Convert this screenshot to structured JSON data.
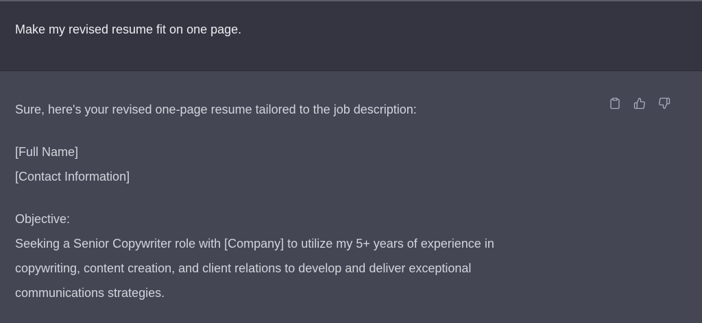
{
  "user_message": {
    "text": "Make my revised resume fit on one page."
  },
  "assistant_message": {
    "intro": "Sure, here's your revised one-page resume tailored to the job description:",
    "name_line": "[Full Name]",
    "contact_line": "[Contact Information]",
    "objective_heading": "Objective:",
    "objective_lines": [
      "Seeking a Senior Copywriter role with [Company] to utilize my 5+ years of experience in",
      "copywriting, content creation, and client relations to develop and deliver exceptional",
      "communications strategies."
    ]
  },
  "actions": {
    "icons": [
      "clipboard-icon",
      "thumbs-up-icon",
      "thumbs-down-icon"
    ]
  },
  "colors": {
    "user_bg": "#343541",
    "assistant_bg": "#444654",
    "text": "#d1d5db",
    "icon": "#acacbe"
  }
}
